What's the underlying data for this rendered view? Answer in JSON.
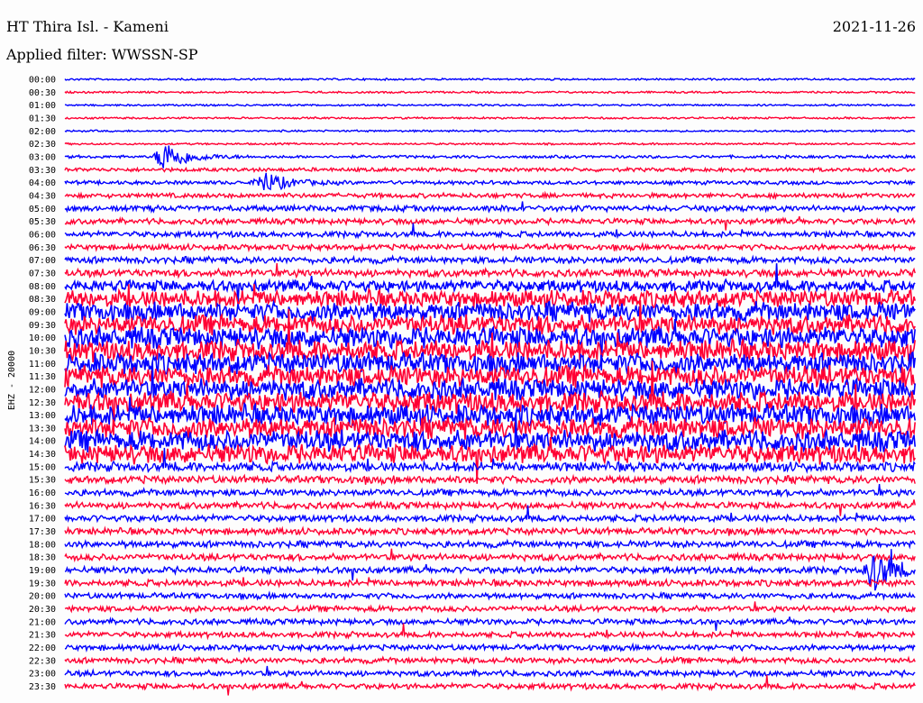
{
  "header": {
    "station": "HT Thira Isl. - Kameni",
    "date": "2021-11-26",
    "filter_label": "Applied filter: WWSSN-SP"
  },
  "chart_data": {
    "type": "line",
    "title": "HT Thira Isl. - Kameni",
    "channel_label": "EHZ - 20000",
    "colors": [
      "#0000ff",
      "#ff0033"
    ],
    "rows": [
      "00:00",
      "00:30",
      "01:00",
      "01:30",
      "02:00",
      "02:30",
      "03:00",
      "03:30",
      "04:00",
      "04:30",
      "05:00",
      "05:30",
      "06:00",
      "06:30",
      "07:00",
      "07:30",
      "08:00",
      "08:30",
      "09:00",
      "09:30",
      "10:00",
      "10:30",
      "11:00",
      "11:30",
      "12:00",
      "12:30",
      "13:00",
      "13:30",
      "14:00",
      "14:30",
      "15:00",
      "15:30",
      "16:00",
      "16:30",
      "17:00",
      "17:30",
      "18:00",
      "18:30",
      "19:00",
      "19:30",
      "20:00",
      "20:30",
      "21:00",
      "21:30",
      "22:00",
      "22:30",
      "23:00",
      "23:30"
    ],
    "noise_level": [
      1,
      1,
      1,
      1,
      1,
      1,
      1.5,
      2,
      2,
      2.5,
      3,
      3,
      3,
      3,
      3.5,
      4,
      6,
      9,
      10,
      10,
      11,
      11,
      11,
      11,
      11,
      11,
      11,
      11,
      11,
      10,
      5,
      4,
      3.5,
      3.5,
      3.5,
      3.5,
      3.5,
      3.5,
      3.5,
      3.5,
      3,
      3,
      3,
      3,
      3,
      3,
      3,
      3
    ],
    "events": [
      {
        "row": "03:00",
        "minute": 3.5,
        "amplitude": 18
      },
      {
        "row": "04:00",
        "minute": 7,
        "amplitude": 12
      },
      {
        "row": "07:00",
        "minute": 31.5,
        "amplitude": 40
      },
      {
        "row": "10:00",
        "minute": 91,
        "amplitude": 50
      },
      {
        "row": "19:00",
        "minute": 28.5,
        "amplitude": 22
      },
      {
        "row": "21:30",
        "minute": 57,
        "amplitude": 60
      },
      {
        "row": "22:00",
        "minute": 58,
        "amplitude": 45
      }
    ]
  }
}
